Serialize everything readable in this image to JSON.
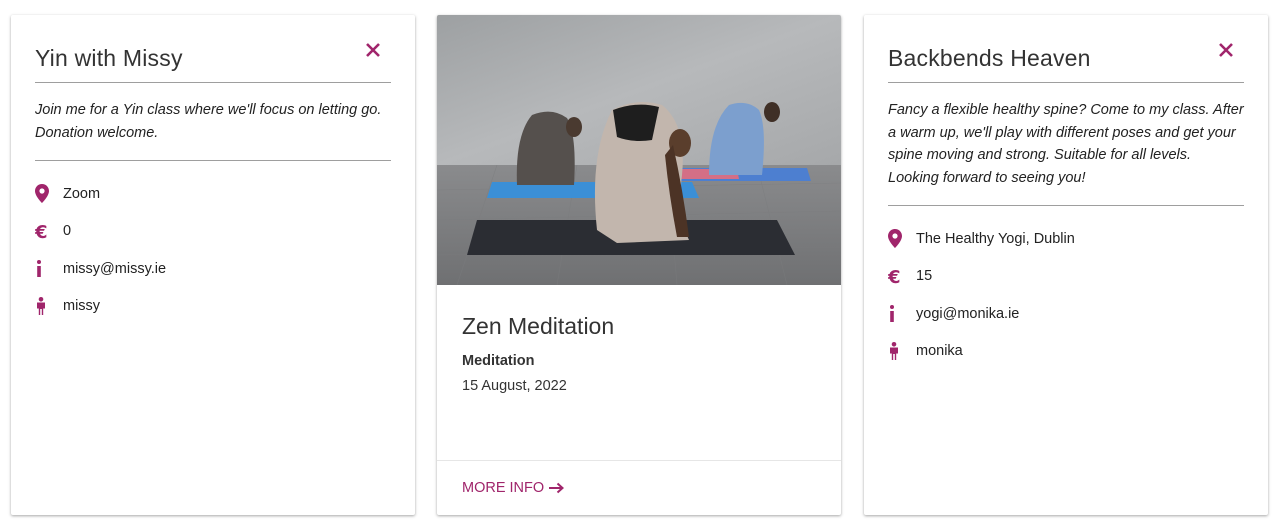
{
  "colors": {
    "accent": "#a0256b",
    "divider": "#9e9e9e",
    "text": "#333333"
  },
  "cards": [
    {
      "title": "Yin with Missy",
      "description": "Join me for a Yin class where we'll focus on letting go. Donation welcome.",
      "close_icon": "close-icon",
      "details": [
        {
          "icon": "location-pin-icon",
          "text": "Zoom"
        },
        {
          "icon": "euro-icon",
          "text": "0"
        },
        {
          "icon": "info-icon",
          "text": "missy@missy.ie"
        },
        {
          "icon": "person-icon",
          "text": "missy"
        }
      ]
    },
    {
      "photo": "yoga-backbend-photo",
      "title": "Zen Meditation",
      "category": "Meditation",
      "date": "15 August, 2022",
      "action_label": "MORE INFO",
      "action_icon": "arrow-right-icon"
    },
    {
      "title": "Backbends Heaven",
      "description": "Fancy a flexible healthy spine? Come to my class. After a warm up, we'll play with different poses and get your spine moving and strong. Suitable for all levels. Looking forward to seeing you!",
      "close_icon": "close-icon",
      "details": [
        {
          "icon": "location-pin-icon",
          "text": "The Healthy Yogi, Dublin"
        },
        {
          "icon": "euro-icon",
          "text": "15"
        },
        {
          "icon": "info-icon",
          "text": "yogi@monika.ie"
        },
        {
          "icon": "person-icon",
          "text": "monika"
        }
      ]
    }
  ]
}
